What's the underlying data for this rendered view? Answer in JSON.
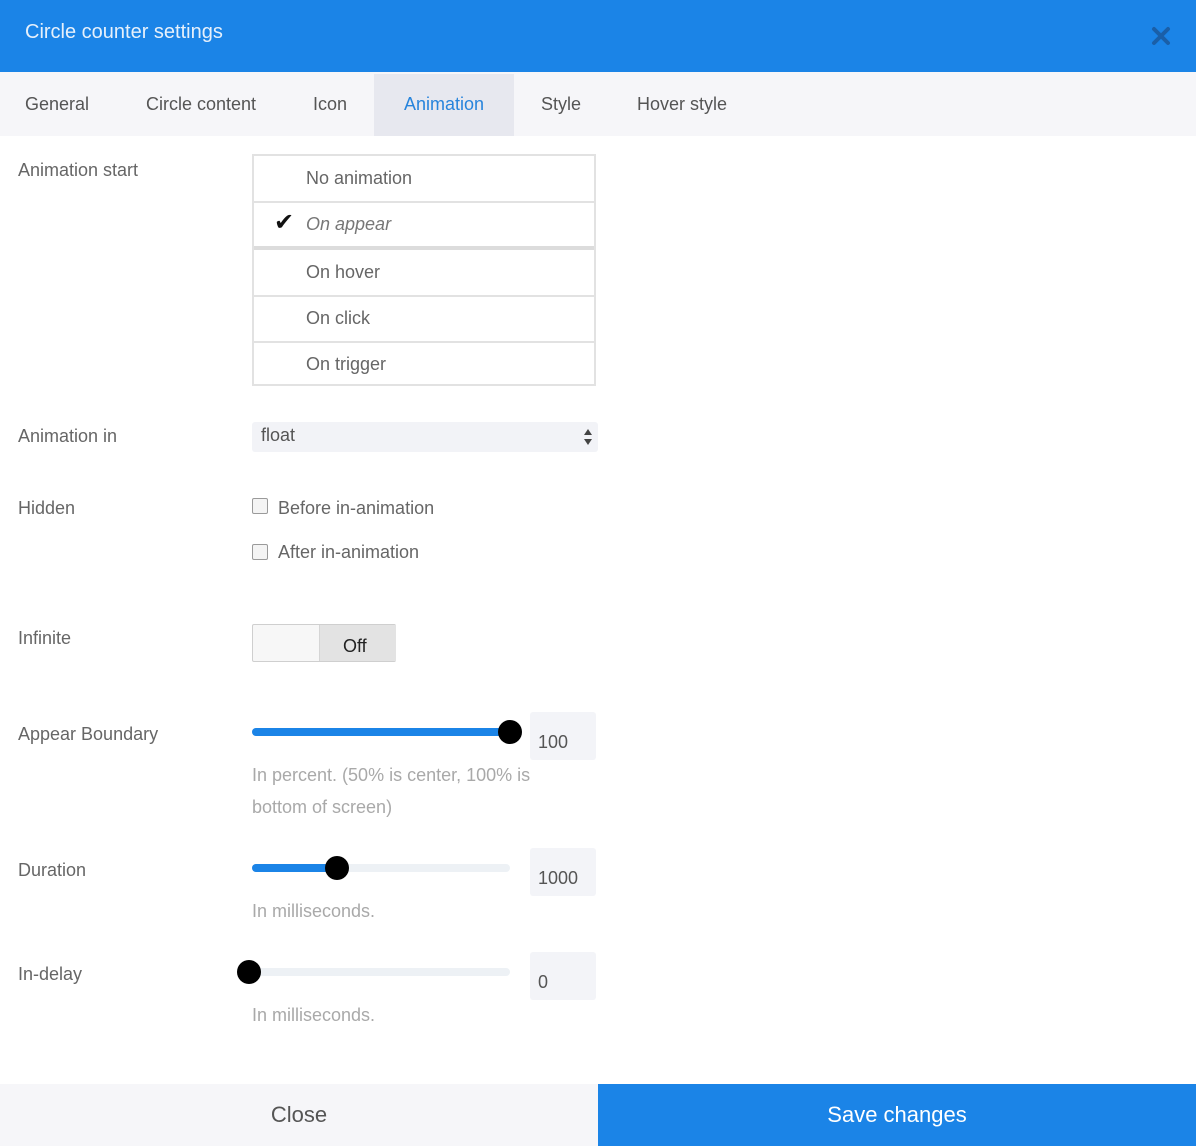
{
  "header": {
    "title": "Circle counter settings",
    "close_icon": "close-icon"
  },
  "tabs": [
    {
      "label": "General",
      "active": false
    },
    {
      "label": "Circle content",
      "active": false
    },
    {
      "label": "Icon",
      "active": false
    },
    {
      "label": "Animation",
      "active": true
    },
    {
      "label": "Style",
      "active": false
    },
    {
      "label": "Hover style",
      "active": false
    }
  ],
  "animation_start": {
    "label": "Animation start",
    "options": [
      "No animation",
      "On appear",
      "On hover",
      "On click",
      "On trigger"
    ],
    "selected": "On appear",
    "check_glyph": "✔"
  },
  "animation_in": {
    "label": "Animation in",
    "value": "float"
  },
  "hidden": {
    "label": "Hidden",
    "options": [
      {
        "label": "Before in-animation",
        "checked": false
      },
      {
        "label": "After in-animation",
        "checked": false
      }
    ]
  },
  "infinite": {
    "label": "Infinite",
    "state": "Off"
  },
  "appear_boundary": {
    "label": "Appear Boundary",
    "value": "100",
    "fraction": 1.0,
    "hint_line1": "In percent. (50% is center, 100% is",
    "hint_line2": "bottom of screen)"
  },
  "duration": {
    "label": "Duration",
    "value": "1000",
    "fraction": 0.33,
    "hint": "In milliseconds."
  },
  "in_delay": {
    "label": "In-delay",
    "value": "0",
    "fraction": 0.0,
    "hint": "In milliseconds."
  },
  "footer": {
    "close_label": "Close",
    "save_label": "Save changes"
  },
  "colors": {
    "accent": "#1b84e7",
    "tab_active_text": "#2784dc"
  }
}
